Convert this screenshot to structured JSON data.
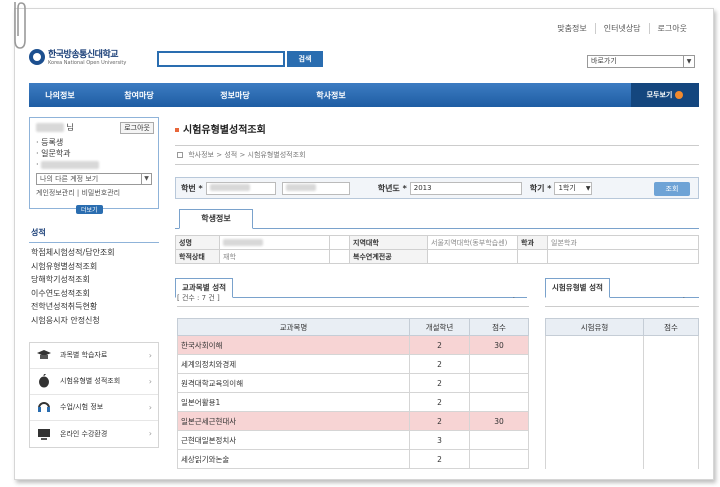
{
  "util_links": [
    "맞춤정보",
    "인터넷상담",
    "로그아웃"
  ],
  "logo": {
    "korean": "한국방송통신대학교",
    "english": "Korea National Open University"
  },
  "search": {
    "button": "검색",
    "value": ""
  },
  "quick_select": {
    "selected": "바로가기"
  },
  "gnb": {
    "items": [
      "나의정보",
      "참여마당",
      "정보마당",
      "학사정보"
    ],
    "all": "모두보기"
  },
  "user": {
    "suffix": "님",
    "logout": "로그아웃",
    "status": [
      "등록생",
      "일문학과"
    ],
    "select_placeholder": "나의 다른 계정 보기",
    "links": [
      "계인정보관리",
      "비밀번호관리"
    ],
    "more": "더보기"
  },
  "menu": {
    "title": "성적",
    "items": [
      "학점체시험성적/답안조회",
      "시험유형별성적조회",
      "당해학기성적조회",
      "이수연도성적조회",
      "전학년성적취득현황",
      "시험응시자 안정신청"
    ]
  },
  "quick_links": [
    "과목별 학습자료",
    "시험유형별 성적조회",
    "수업/시험 정보",
    "온라인 수강환경"
  ],
  "page": {
    "title": "시험유형별성적조회",
    "breadcrumb": [
      "학사정보",
      "성적",
      "시험유형별성적조회"
    ]
  },
  "filter": {
    "student_no_label": "학번",
    "year_label": "학년도",
    "year_value": "2013",
    "term_label": "학기",
    "term_value": "1학기",
    "search_btn": "조회"
  },
  "tab": "학생정보",
  "student_info": {
    "row1": {
      "name_label": "성명",
      "region_label": "지역대학",
      "region_value": "서울지역대학(동부학습센)",
      "dept_label": "학과",
      "dept_value": "일본학과"
    },
    "row2": {
      "status_label": "학적상태",
      "status_value": "재학",
      "double_label": "복수연계전공"
    }
  },
  "subjects": {
    "section_title": "교과목별 성적",
    "count_text": "[ 건수 : 7 건 ]",
    "headers": [
      "교과목명",
      "개설학년",
      "점수"
    ],
    "rows": [
      {
        "name": "한국사회이해",
        "grade": "2",
        "score": "30"
      },
      {
        "name": "세계의정치와경제",
        "grade": "2",
        "score": ""
      },
      {
        "name": "원격대학교육의이해",
        "grade": "2",
        "score": ""
      },
      {
        "name": "일본어활용1",
        "grade": "2",
        "score": ""
      },
      {
        "name": "일본근세근현대사",
        "grade": "2",
        "score": "30"
      },
      {
        "name": "근현대일본정치사",
        "grade": "3",
        "score": ""
      },
      {
        "name": "세상읽기와논술",
        "grade": "2",
        "score": ""
      }
    ]
  },
  "by_type": {
    "section_title": "시험유형별 성적",
    "headers": [
      "시험유형",
      "점수"
    ]
  }
}
